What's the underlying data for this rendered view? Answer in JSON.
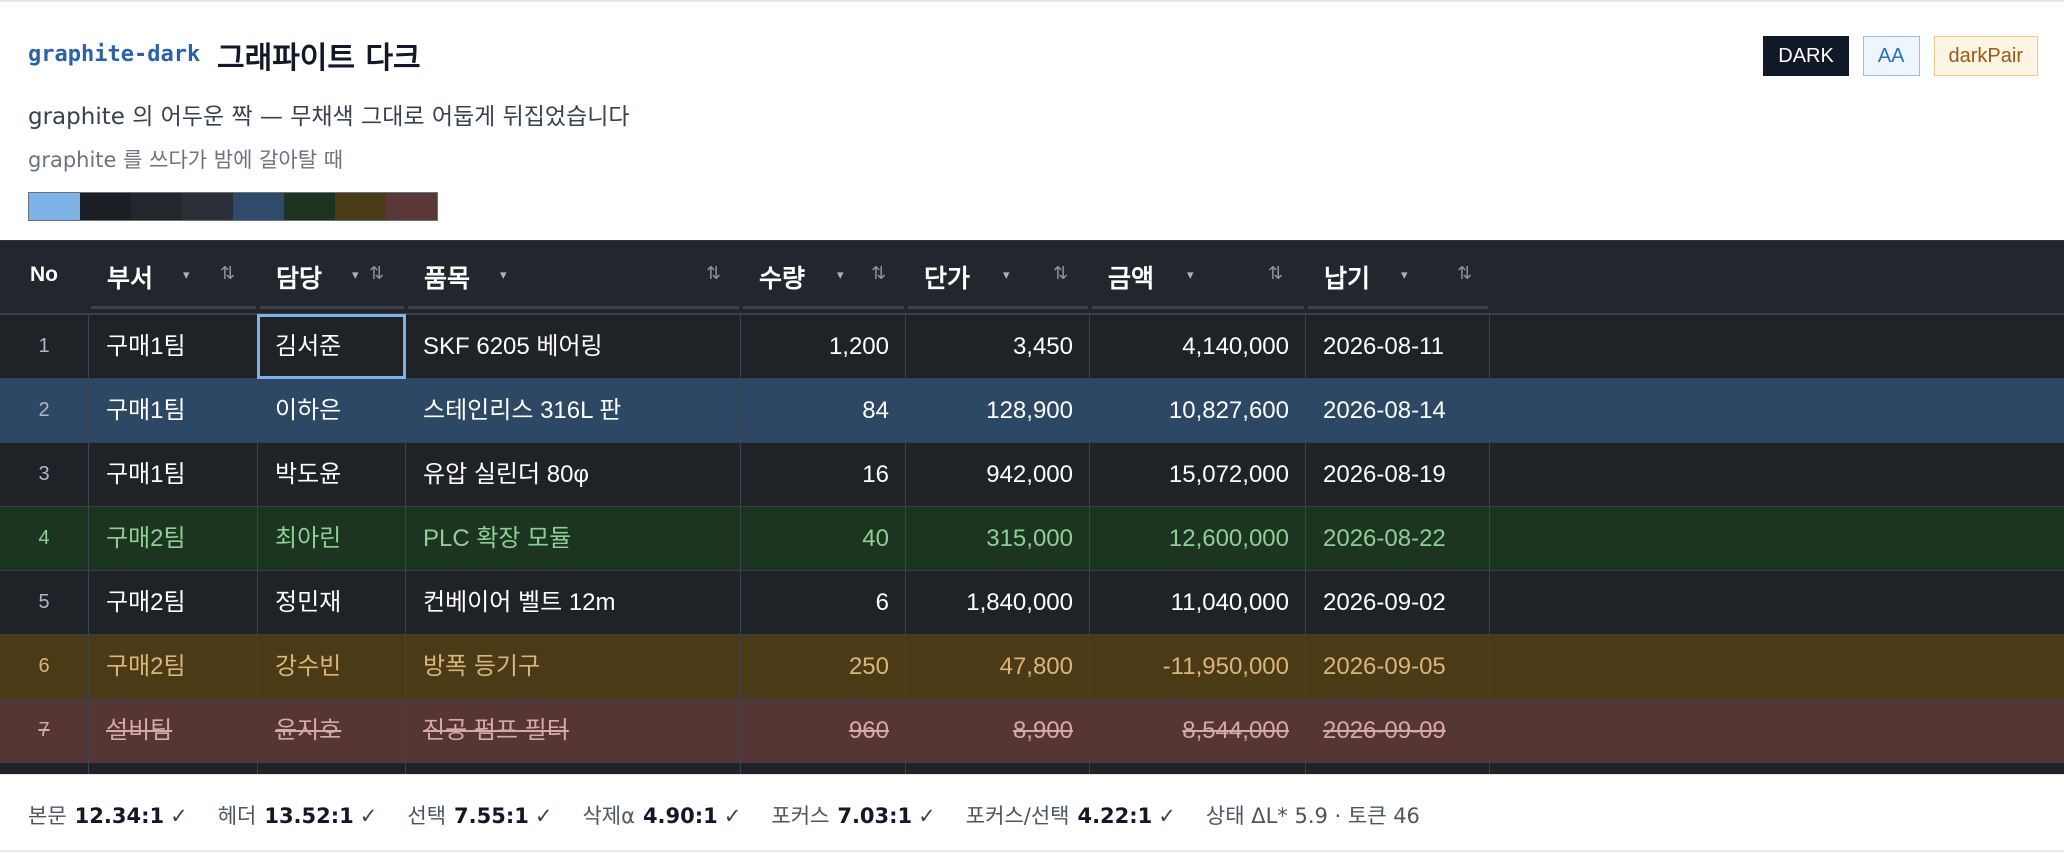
{
  "theme": {
    "code": "graphite-dark",
    "title": "그래파이트 다크",
    "description": "graphite 의 어두운 짝 — 무채색 그대로 어둡게 뒤집었습니다",
    "subtitle": "graphite 를 쓰다가 밤에 갈아탈 때",
    "badges": [
      "DARK",
      "AA",
      "darkPair"
    ],
    "swatches": [
      "#7fb3e8",
      "#1b1f24",
      "#22272e",
      "#2a2f38",
      "#2f4a6a",
      "#1c3320",
      "#4a3c16",
      "#5a3838"
    ]
  },
  "table": {
    "columns": [
      {
        "label": "No",
        "caret": "",
        "sort": ""
      },
      {
        "label": "부서",
        "caret": "▾",
        "sort": "⇅"
      },
      {
        "label": "담당",
        "caret": "▾",
        "sort": "⇅"
      },
      {
        "label": "품목",
        "caret": "▾",
        "sort": "⇅"
      },
      {
        "label": "수량",
        "caret": "▾",
        "sort": "⇅"
      },
      {
        "label": "단가",
        "caret": "▾",
        "sort": "⇅"
      },
      {
        "label": "금액",
        "caret": "▾",
        "sort": "⇅"
      },
      {
        "label": "납기",
        "caret": "▾",
        "sort": "⇅"
      }
    ],
    "rows": [
      {
        "no": "1",
        "dept": "구매1팀",
        "owner": "김서준",
        "item": "SKF 6205 베어링",
        "qty": "1,200",
        "price": "3,450",
        "amount": "4,140,000",
        "due": "2026-08-11",
        "state": "normal"
      },
      {
        "no": "2",
        "dept": "구매1팀",
        "owner": "이하은",
        "item": "스테인리스 316L 판",
        "qty": "84",
        "price": "128,900",
        "amount": "10,827,600",
        "due": "2026-08-14",
        "state": "selected"
      },
      {
        "no": "3",
        "dept": "구매1팀",
        "owner": "박도윤",
        "item": "유압 실린더 80φ",
        "qty": "16",
        "price": "942,000",
        "amount": "15,072,000",
        "due": "2026-08-19",
        "state": "normal"
      },
      {
        "no": "4",
        "dept": "구매2팀",
        "owner": "최아린",
        "item": "PLC 확장 모듈",
        "qty": "40",
        "price": "315,000",
        "amount": "12,600,000",
        "due": "2026-08-22",
        "state": "added"
      },
      {
        "no": "5",
        "dept": "구매2팀",
        "owner": "정민재",
        "item": "컨베이어 벨트 12m",
        "qty": "6",
        "price": "1,840,000",
        "amount": "11,040,000",
        "due": "2026-09-02",
        "state": "normal"
      },
      {
        "no": "6",
        "dept": "구매2팀",
        "owner": "강수빈",
        "item": "방폭 등기구",
        "qty": "250",
        "price": "47,800",
        "amount": "-11,950,000",
        "due": "2026-09-05",
        "state": "warning"
      },
      {
        "no": "7",
        "dept": "설비팀",
        "owner": "윤지호",
        "item": "진공 펌프 필터",
        "qty": "960",
        "price": "8,900",
        "amount": "8,544,000",
        "due": "2026-09-09",
        "state": "deleted"
      }
    ],
    "colors": {
      "normal": {
        "bg": "#1f2328",
        "fg": "#ffffff"
      },
      "selected": {
        "bg": "#2d4865",
        "fg": "#ffffff"
      },
      "added": {
        "bg": "#1b3520",
        "fg": "#8fcf94"
      },
      "warning": {
        "bg": "#4a3a16",
        "fg": "#d9b57a"
      },
      "deleted": {
        "bg": "#563535",
        "fg": "#d6a8a8"
      },
      "focus": "#7fb3e8"
    }
  },
  "contrast": [
    {
      "label": "본문",
      "value": "12.34:1",
      "mark": "✓"
    },
    {
      "label": "헤더",
      "value": "13.52:1",
      "mark": "✓"
    },
    {
      "label": "선택",
      "value": "7.55:1",
      "mark": "✓"
    },
    {
      "label": "삭제α",
      "value": "4.90:1",
      "mark": "✓"
    },
    {
      "label": "포커스",
      "value": "7.03:1",
      "mark": "✓"
    },
    {
      "label": "포커스/선택",
      "value": "4.22:1",
      "mark": "✓"
    }
  ],
  "state_note": "상태 ΔL* 5.9 · 토큰 46"
}
